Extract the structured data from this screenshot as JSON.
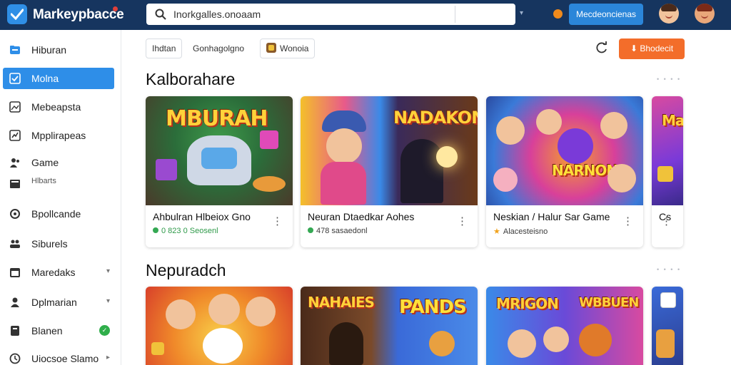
{
  "header": {
    "brand": "Markeypbacce",
    "search_text": "Inorkgalles.onoaam",
    "caret": "▾",
    "cta_label": "Mecdeoncienas"
  },
  "sidebar": {
    "items": [
      {
        "label": "Hiburan",
        "icon": "folder-icon"
      },
      {
        "label": "Molna",
        "icon": "checklist-icon",
        "active": true
      },
      {
        "label": "Mebeapsta",
        "icon": "image-icon"
      },
      {
        "label": "Mpplirapeas",
        "icon": "trend-icon"
      },
      {
        "label": "Game",
        "icon": "users-icon"
      },
      {
        "label": "Hlbarts",
        "icon": "grid-icon"
      },
      {
        "label": "Bpollcande",
        "icon": "settings-icon"
      },
      {
        "label": "Siburels",
        "icon": "group-icon"
      },
      {
        "label": "Maredaks",
        "icon": "calendar-icon",
        "chevron": "▾"
      },
      {
        "label": "Dplmarian",
        "icon": "person-icon",
        "chevron": "▾"
      },
      {
        "label": "Blanen",
        "icon": "note-icon",
        "badge": "✓"
      },
      {
        "label": "Uiocsoe Slamo",
        "icon": "clock-icon",
        "chevron": "▸"
      }
    ]
  },
  "filters": {
    "chip_1": "Ihdtan",
    "chip_2": "Gonhagolgno",
    "chip_3": "Wonoia",
    "action_label": "Bhodecit"
  },
  "sections": [
    {
      "title": "Kalborahare",
      "see_all": "• • • •",
      "cards": [
        {
          "title": "Ahbulran Hlbeiox Gno",
          "meta": "0 823  0 Seosenl",
          "art_word": "MBURAH",
          "meta_icon": "dot"
        },
        {
          "title": "Neuran Dtaedkar Aohes",
          "meta": "478 sasaedonl",
          "art_word": "NADAKON",
          "meta_icon": "dot"
        },
        {
          "title": "Neskian / Halur Sar Game",
          "meta": "Alacesteisno",
          "art_word": "NARNON",
          "meta_icon": "star"
        },
        {
          "title": "Cs",
          "meta": "",
          "art_word": "Ma",
          "meta_icon": ""
        }
      ]
    },
    {
      "title": "Nepuradch",
      "see_all": "• • • •",
      "cards": [
        {
          "art_word": ""
        },
        {
          "art_word": "NAHAIES"
        },
        {
          "art_word": "MRIGON"
        },
        {
          "art_word": ""
        }
      ],
      "card2_words": [
        "PANDS",
        "WBBUEN"
      ]
    }
  ]
}
